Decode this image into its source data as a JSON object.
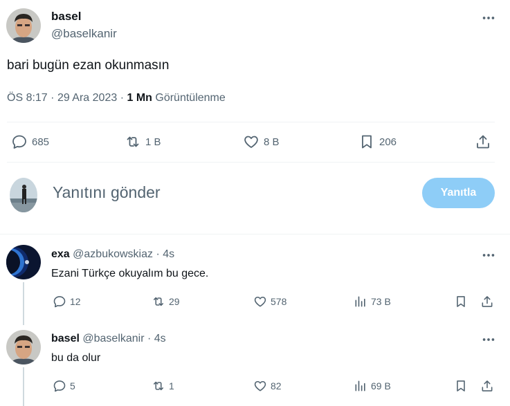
{
  "main_tweet": {
    "name": "basel",
    "handle": "@baselkanir",
    "text": "bari bugün ezan okunmasın",
    "time": "ÖS 8:17",
    "sep1": "·",
    "date": "29 Ara 2023",
    "sep2": "·",
    "views_count": "1 Mn",
    "views_label": "Görüntülenme",
    "stats": {
      "replies": "685",
      "retweets": "1 B",
      "likes": "8 B",
      "bookmarks": "206"
    }
  },
  "composer": {
    "placeholder": "Yanıtını gönder",
    "button": "Yanıtla",
    "button_color": "#8ecdf7"
  },
  "replies": [
    {
      "name": "exa",
      "handle": "@azbukowskiaz",
      "dot": "·",
      "time": "4s",
      "text": "Ezani Türkçe okuyalım bu gece.",
      "replies": "12",
      "retweets": "29",
      "likes": "578",
      "views": "73 B"
    },
    {
      "name": "basel",
      "handle": "@baselkanir",
      "dot": "·",
      "time": "4s",
      "text": "bu da olur",
      "replies": "5",
      "retweets": "1",
      "likes": "82",
      "views": "69 B"
    }
  ],
  "colors": {
    "text_primary": "#0f1419",
    "text_secondary": "#536471",
    "divider": "#eff3f4"
  }
}
